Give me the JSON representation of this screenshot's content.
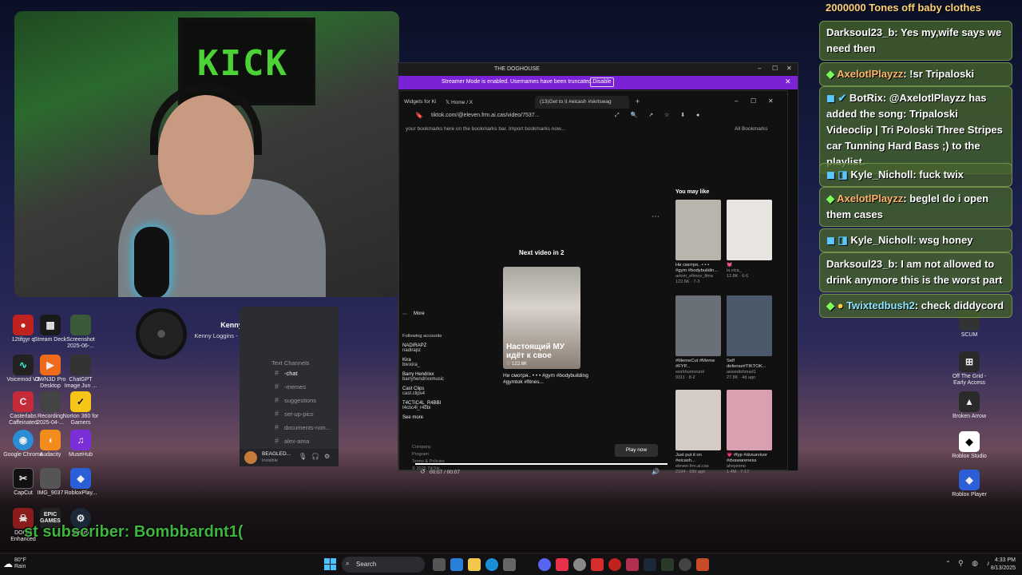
{
  "desktop_icons": [
    {
      "label": "12tifgyr q",
      "color": "#c0221e"
    },
    {
      "label": "Stream Deck",
      "color": "#1a1a1a"
    },
    {
      "label": "Screenshot 2025-06-...",
      "color": "#3b5a3a"
    },
    {
      "label": "Voicemod V3",
      "color": "#222"
    },
    {
      "label": "OWN3D Pro Desktop",
      "color": "#f06a1c"
    },
    {
      "label": "ChatGPT Image Jun ...",
      "color": "#333"
    },
    {
      "label": "Casterlabs Caffeinated",
      "color": "#c62b3a"
    },
    {
      "label": "Recording 2025-04-...",
      "color": "#444"
    },
    {
      "label": "Norton 360 for Gamers",
      "color": "#f5c518"
    },
    {
      "label": "Google Chrome",
      "color": "#2a8dd6"
    },
    {
      "label": "Audacity",
      "color": "#f28c1c"
    },
    {
      "label": "MuseHub",
      "color": "#7a2fd8"
    },
    {
      "label": "CapCut",
      "color": "#111"
    },
    {
      "label": "IMG_9037",
      "color": "#555"
    },
    {
      "label": "RobloxPlay...",
      "color": "#2a5fd8"
    },
    {
      "label": "DOOM Enhanced",
      "color": "#8a1c1c"
    },
    {
      "label": "EPIC GAMES",
      "color": "#222"
    },
    {
      "label": "Steam",
      "color": "#1b2838"
    }
  ],
  "right_icons": [
    {
      "label": "SCUM"
    },
    {
      "label": "Off The Grid - Early Access"
    },
    {
      "label": "Broken Arrow"
    },
    {
      "label": "Roblox Studio"
    },
    {
      "label": "Roblox Player"
    }
  ],
  "webcam": {
    "sign_text": "KICK"
  },
  "now_playing": {
    "artist": "KennyLogginsVEVO",
    "title": "Kenny Loggins - Danger Zone (Official Video - Top Gun)"
  },
  "discord": {
    "header": "Text Channels",
    "channels": [
      "-chat",
      "-memes",
      "suggestions",
      "set-up-pics",
      "documents-non...",
      "alex-area"
    ],
    "user": "BEAGLED...",
    "status": "Invisible"
  },
  "app_window": {
    "title": "THE DOGHOUSE",
    "banner_text": "Streamer Mode is enabled. Usernames have been truncated.",
    "disable_label": "Disable"
  },
  "browser": {
    "tabs": [
      "Widgets for Ki",
      "Home / X",
      "(13)Get to it #eicash #skrtswag"
    ],
    "url": "tiktok.com/@eleven.frm.ai.cas/video/7537...",
    "bookmarks_text": "your bookmarks here on the bookmarks bar. Import bookmarks now...",
    "all_bookmarks": "All Bookmarks"
  },
  "tiktok": {
    "next_label": "Next video in 2",
    "thumb_caption": "Настоящий МУ идёт к свое",
    "likes": "122.6K",
    "desc": "Ни смотря.. • • • #gym #bodybuilding #gymtok #fitnes...",
    "play_now": "Play now",
    "time": "00:07 / 00:07",
    "progress": 1.0,
    "more_label": "More",
    "following_label": "Following accounts",
    "following": [
      {
        "name": "NADIRAPZ",
        "handle": "nadirapz"
      },
      {
        "name": "Kira",
        "handle": "bw.kira_"
      },
      {
        "name": "Barry Hendrixx",
        "handle": "barryhendrixxmusic"
      },
      {
        "name": "Cast Clips",
        "handle": "cast.clips4"
      },
      {
        "name": "T4CTIC4L_R4BBI",
        "handle": "t4ctic4l_r4bbi"
      }
    ],
    "see_more": "See more",
    "footer_links": [
      "Company",
      "Program",
      "Terms & Policies",
      "© 2025 TikTok"
    ],
    "may_like_label": "You may like",
    "recommendations": [
      {
        "caption": "Ни смотря.. • • • #gym #bodybuildin...",
        "user": "artom_efimov_fitnа",
        "stats": "122.6K · 7-3",
        "color": "#b9b4ac"
      },
      {
        "caption": "💓",
        "user": "la.vica_",
        "stats": "12.8K · 6-6",
        "color": "#e8e4e0"
      },
      {
        "caption": "#MemeCut #Meme #FYP...",
        "user": "workhumorunit",
        "stats": "9311 · 8-2",
        "color": "#6a7078"
      },
      {
        "caption": "Self defense#TIKTOK...",
        "user": "aswedishmad1",
        "stats": "27.8K · 4d ago",
        "color": "#4a5a6a"
      },
      {
        "caption": "Just put it on #eicash...",
        "user": "eleven.frm.ai.cas",
        "stats": "2104 · 16h ago",
        "color": "#d4ccc4"
      },
      {
        "caption": "💗 #fyp #dvsurvivor #dvawareness",
        "user": "ahsyenno",
        "stats": "1.4M · 7-17",
        "color": "#d9a0b0"
      }
    ]
  },
  "chat": [
    {
      "user": "",
      "text": "2000000 Tones off baby clothes",
      "user_color": "#ffd27a"
    },
    {
      "user": "Darksoul23_b",
      "text": ": Yes my,wife says we need then",
      "user_color": "#ffffff"
    },
    {
      "user": "AxelotlPlayzz",
      "text": ": !sr Tripaloski",
      "user_color": "#ffb46a"
    },
    {
      "user": "BotRix",
      "text": ": @AxelotlPlayzz has added the song: Tripaloski Videoclip | Tri Poloski Three Stripes car Tunning Hard Bass ;) to the playlist.",
      "user_color": "#ffffff"
    },
    {
      "user": "Kyle_Nicholl",
      "text": ": fuck twix",
      "user_color": "#ffffff"
    },
    {
      "user": "AxelotlPlayzz",
      "text": ": beglel do i open them cases",
      "user_color": "#ffb46a"
    },
    {
      "user": "Kyle_Nicholl",
      "text": ": wsg honey",
      "user_color": "#ffffff"
    },
    {
      "user": "Darksoul23_b",
      "text": ": I am not allowed to drink anymore this is the worst part",
      "user_color": "#ffffff"
    },
    {
      "user": "Twixtedbush2",
      "text": ": check diddycord",
      "user_color": "#8fe3ff"
    }
  ],
  "subscriber_ticker": "st subscriber: Bombbardnt1(",
  "taskbar": {
    "weather_temp": "80°F",
    "weather_desc": "Rain",
    "search_placeholder": "Search",
    "time": "4:33 PM",
    "date": "8/13/2025"
  }
}
